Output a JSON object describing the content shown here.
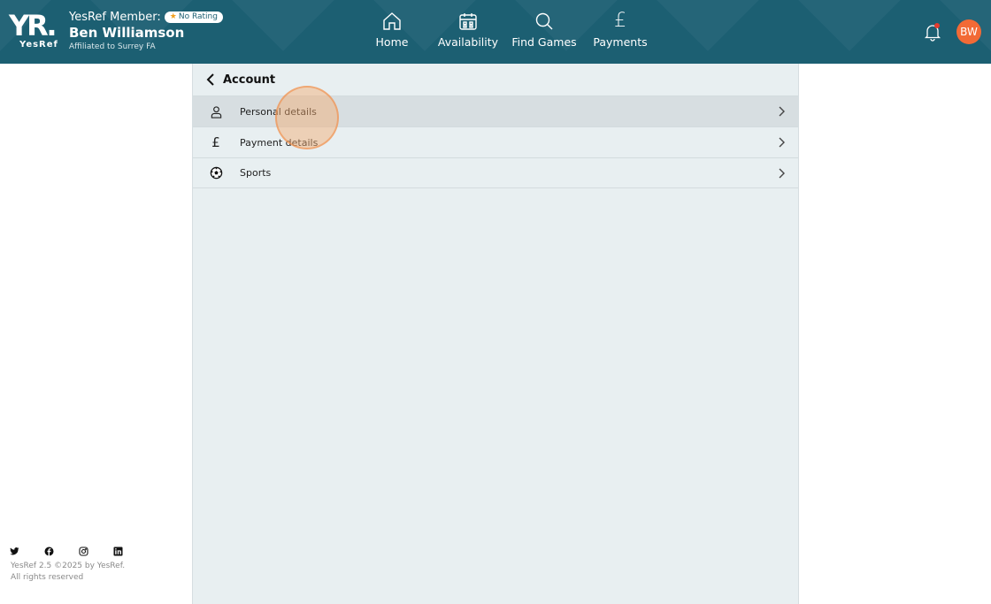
{
  "header": {
    "logo_text": "YR.",
    "logo_sub": "YesRef",
    "member_prefix": "YesRef Member:",
    "rating_badge": "No Rating",
    "member_name": "Ben Williamson",
    "affiliation": "Affiliated to Surrey FA",
    "nav": [
      {
        "label": "Home",
        "icon": "home-icon"
      },
      {
        "label": "Availability",
        "icon": "calendar-icon"
      },
      {
        "label": "Find Games",
        "icon": "search-icon"
      },
      {
        "label": "Payments",
        "icon": "pound-icon"
      }
    ],
    "notification_icon": "bell-icon",
    "avatar_initials": "BW",
    "colors": {
      "header_bg": "#1c5f72",
      "avatar_bg": "#f26a36",
      "notification_dot": "#e33b2e"
    }
  },
  "account": {
    "title": "Account",
    "items": [
      {
        "label": "Personal details",
        "icon": "person-icon",
        "active": true
      },
      {
        "label": "Payment details",
        "icon": "pound-icon",
        "active": false
      },
      {
        "label": "Sports",
        "icon": "football-icon",
        "active": false
      }
    ]
  },
  "footer": {
    "social": [
      "twitter-icon",
      "facebook-icon",
      "instagram-icon",
      "linkedin-icon"
    ],
    "version_line": "YesRef 2.5 ©2025 by YesRef.",
    "rights_line": "All rights reserved"
  }
}
